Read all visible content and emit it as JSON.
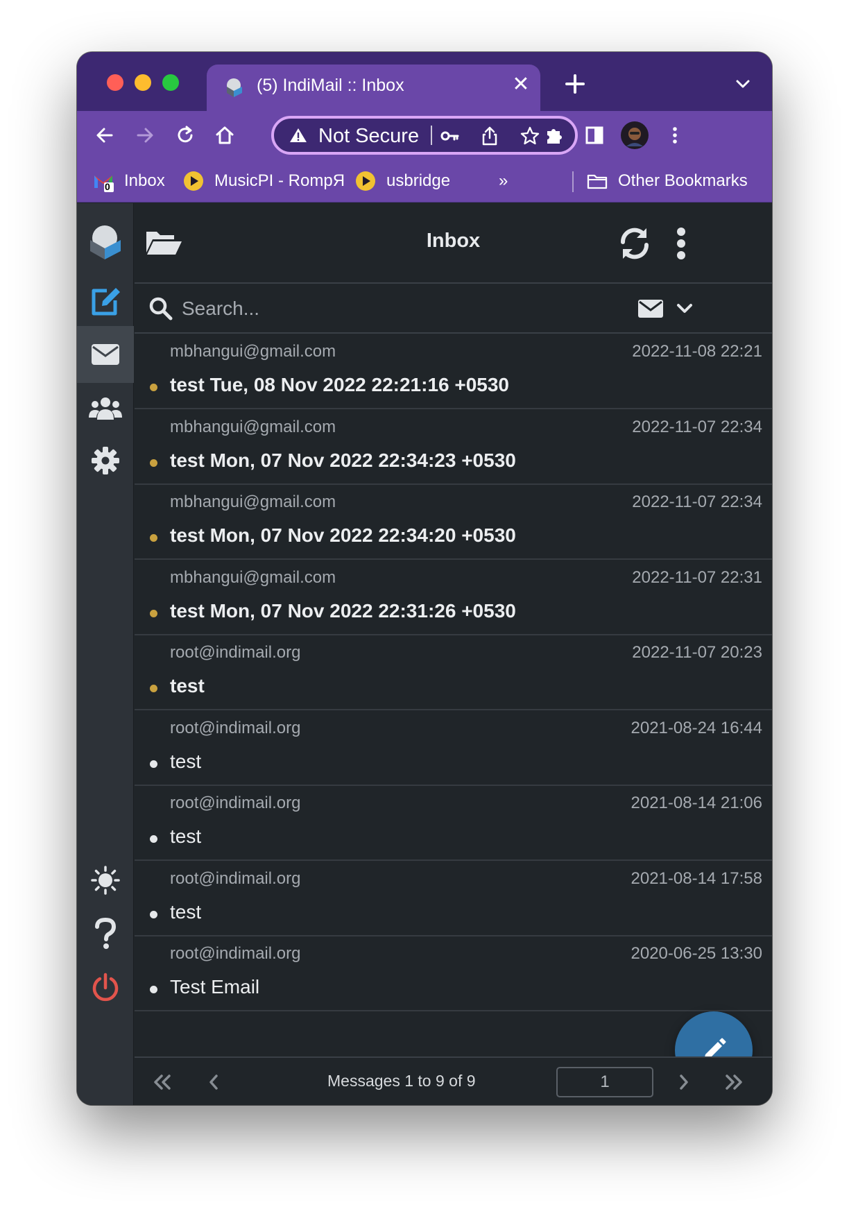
{
  "browser": {
    "tab_title": "(5) IndiMail :: Inbox",
    "tab_close": "✕",
    "omnibox_text": "Not Secure",
    "bookmarks": [
      {
        "label": "Inbox",
        "badge": "0"
      },
      {
        "label": "MusicPI - RompЯ"
      },
      {
        "label": "usbridge"
      }
    ],
    "more_bookmarks": "»",
    "other_bookmarks": "Other Bookmarks"
  },
  "app": {
    "header_title": "Inbox",
    "search_placeholder": "Search...",
    "messages": [
      {
        "from": "mbhangui@gmail.com",
        "date": "2022-11-08 22:21",
        "subject": "test Tue, 08 Nov 2022 22:21:16 +0530",
        "unread": true
      },
      {
        "from": "mbhangui@gmail.com",
        "date": "2022-11-07 22:34",
        "subject": "test Mon, 07 Nov 2022 22:34:23 +0530",
        "unread": true
      },
      {
        "from": "mbhangui@gmail.com",
        "date": "2022-11-07 22:34",
        "subject": "test Mon, 07 Nov 2022 22:34:20 +0530",
        "unread": true
      },
      {
        "from": "mbhangui@gmail.com",
        "date": "2022-11-07 22:31",
        "subject": "test Mon, 07 Nov 2022 22:31:26 +0530",
        "unread": true
      },
      {
        "from": "root@indimail.org",
        "date": "2022-11-07 20:23",
        "subject": "test",
        "unread": true
      },
      {
        "from": "root@indimail.org",
        "date": "2021-08-24 16:44",
        "subject": "test",
        "unread": false
      },
      {
        "from": "root@indimail.org",
        "date": "2021-08-14 21:06",
        "subject": "test",
        "unread": false
      },
      {
        "from": "root@indimail.org",
        "date": "2021-08-14 17:58",
        "subject": "test",
        "unread": false
      },
      {
        "from": "root@indimail.org",
        "date": "2020-06-25 13:30",
        "subject": "Test Email",
        "unread": false
      }
    ],
    "pagination": {
      "count_text": "Messages 1 to 9 of 9",
      "page": "1"
    }
  },
  "colors": {
    "unread_dot": "#c9a13f",
    "read_dot": "#e6e8ea",
    "accent": "#2f6fa3",
    "brand_purple": "#6a47a8",
    "logout_red": "#e2544c"
  }
}
